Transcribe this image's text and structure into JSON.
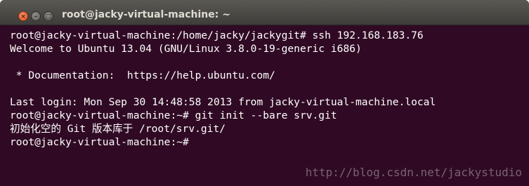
{
  "window": {
    "title": "root@jacky-virtual-machine: ~",
    "buttons": {
      "close": "×",
      "minimize": "–",
      "maximize": "□"
    }
  },
  "terminal": {
    "lines": [
      "root@jacky-virtual-machine:/home/jacky/jackygit# ssh 192.168.183.76",
      "Welcome to Ubuntu 13.04 (GNU/Linux 3.8.0-19-generic i686)",
      "",
      " * Documentation:  https://help.ubuntu.com/",
      "",
      "Last login: Mon Sep 30 14:48:58 2013 from jacky-virtual-machine.local",
      "root@jacky-virtual-machine:~# git init --bare srv.git",
      "初始化空的 Git 版本库于 /root/srv.git/",
      "root@jacky-virtual-machine:~#"
    ]
  },
  "watermark": "http://blog.csdn.net/jackystudio",
  "colors": {
    "terminal_bg": "#300a24",
    "terminal_fg": "#ffffff",
    "close_button": "#e4521f"
  }
}
